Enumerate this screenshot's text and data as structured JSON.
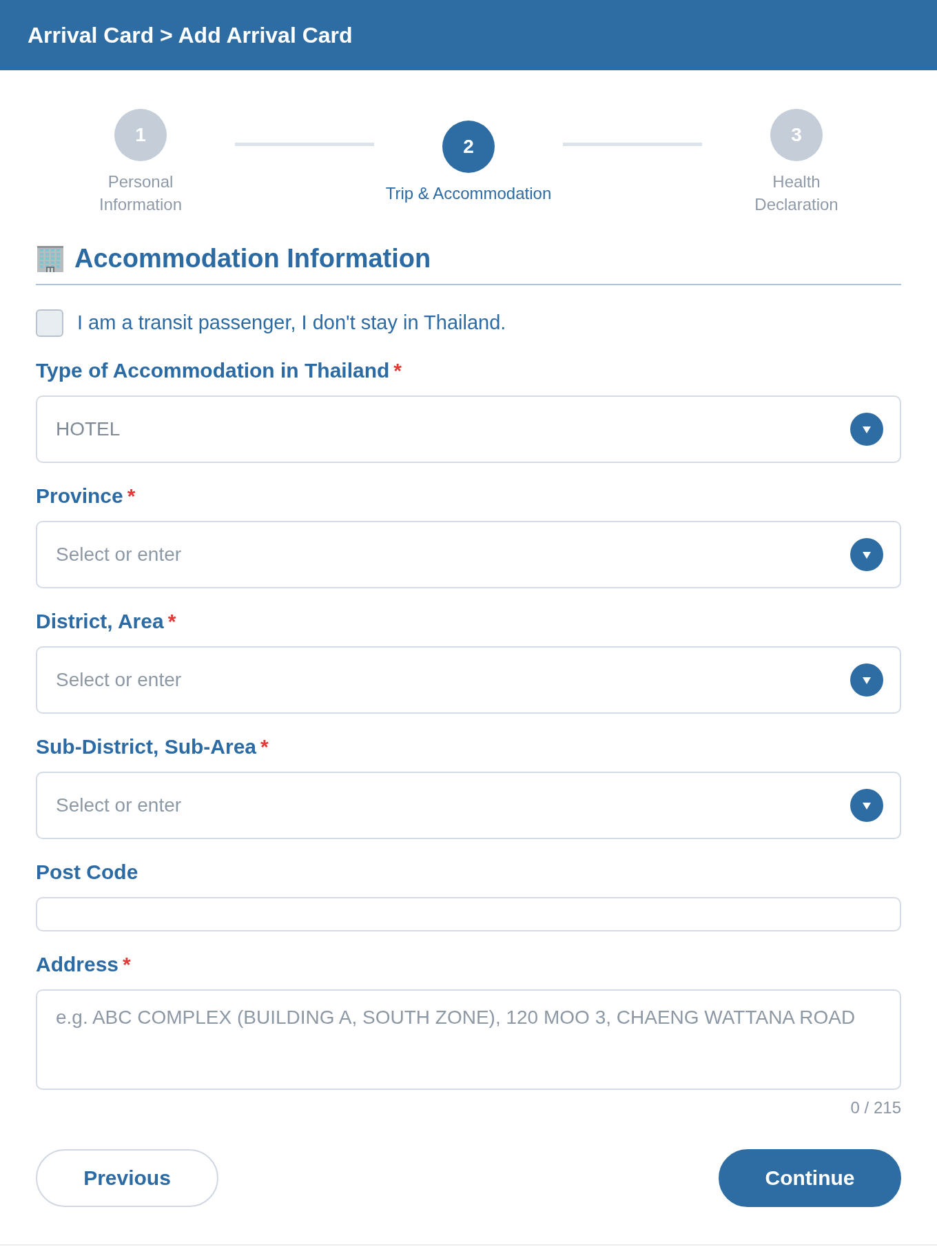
{
  "header": {
    "title": "Arrival Card > Add Arrival Card"
  },
  "stepper": {
    "steps": [
      {
        "number": "1",
        "label": "Personal Information",
        "selected": false
      },
      {
        "number": "2",
        "label": "Trip & Accommodation",
        "selected": true
      },
      {
        "number": "3",
        "label": "Health Declaration",
        "selected": false
      }
    ]
  },
  "section": {
    "title": "Accommodation Information"
  },
  "transit_checkbox": {
    "label": "I am a transit passenger, I don't stay in Thailand.",
    "checked": false
  },
  "fields": [
    {
      "kind": "select",
      "label": "Type of Accommodation in Thailand",
      "required_mark": "*",
      "value": "HOTEL"
    },
    {
      "kind": "select",
      "label": "Province",
      "required_mark": "*",
      "placeholder": "Select or enter"
    },
    {
      "kind": "select",
      "label": "District, Area",
      "required_mark": "*",
      "placeholder": "Select or enter"
    },
    {
      "kind": "select",
      "label": "Sub-District, Sub-Area",
      "required_mark": "*",
      "placeholder": "Select or enter"
    },
    {
      "kind": "text",
      "label": "Post Code"
    },
    {
      "kind": "textarea",
      "label": "Address",
      "required_mark": "*",
      "placeholder": "e.g. ABC COMPLEX (BUILDING A, SOUTH ZONE), 120 MOO 3, CHAENG WATTANA ROAD",
      "counter": "0 / 215"
    }
  ],
  "buttons": [
    {
      "kind": "outline",
      "label": "Previous"
    },
    {
      "kind": "filled",
      "label": "Continue"
    }
  ]
}
